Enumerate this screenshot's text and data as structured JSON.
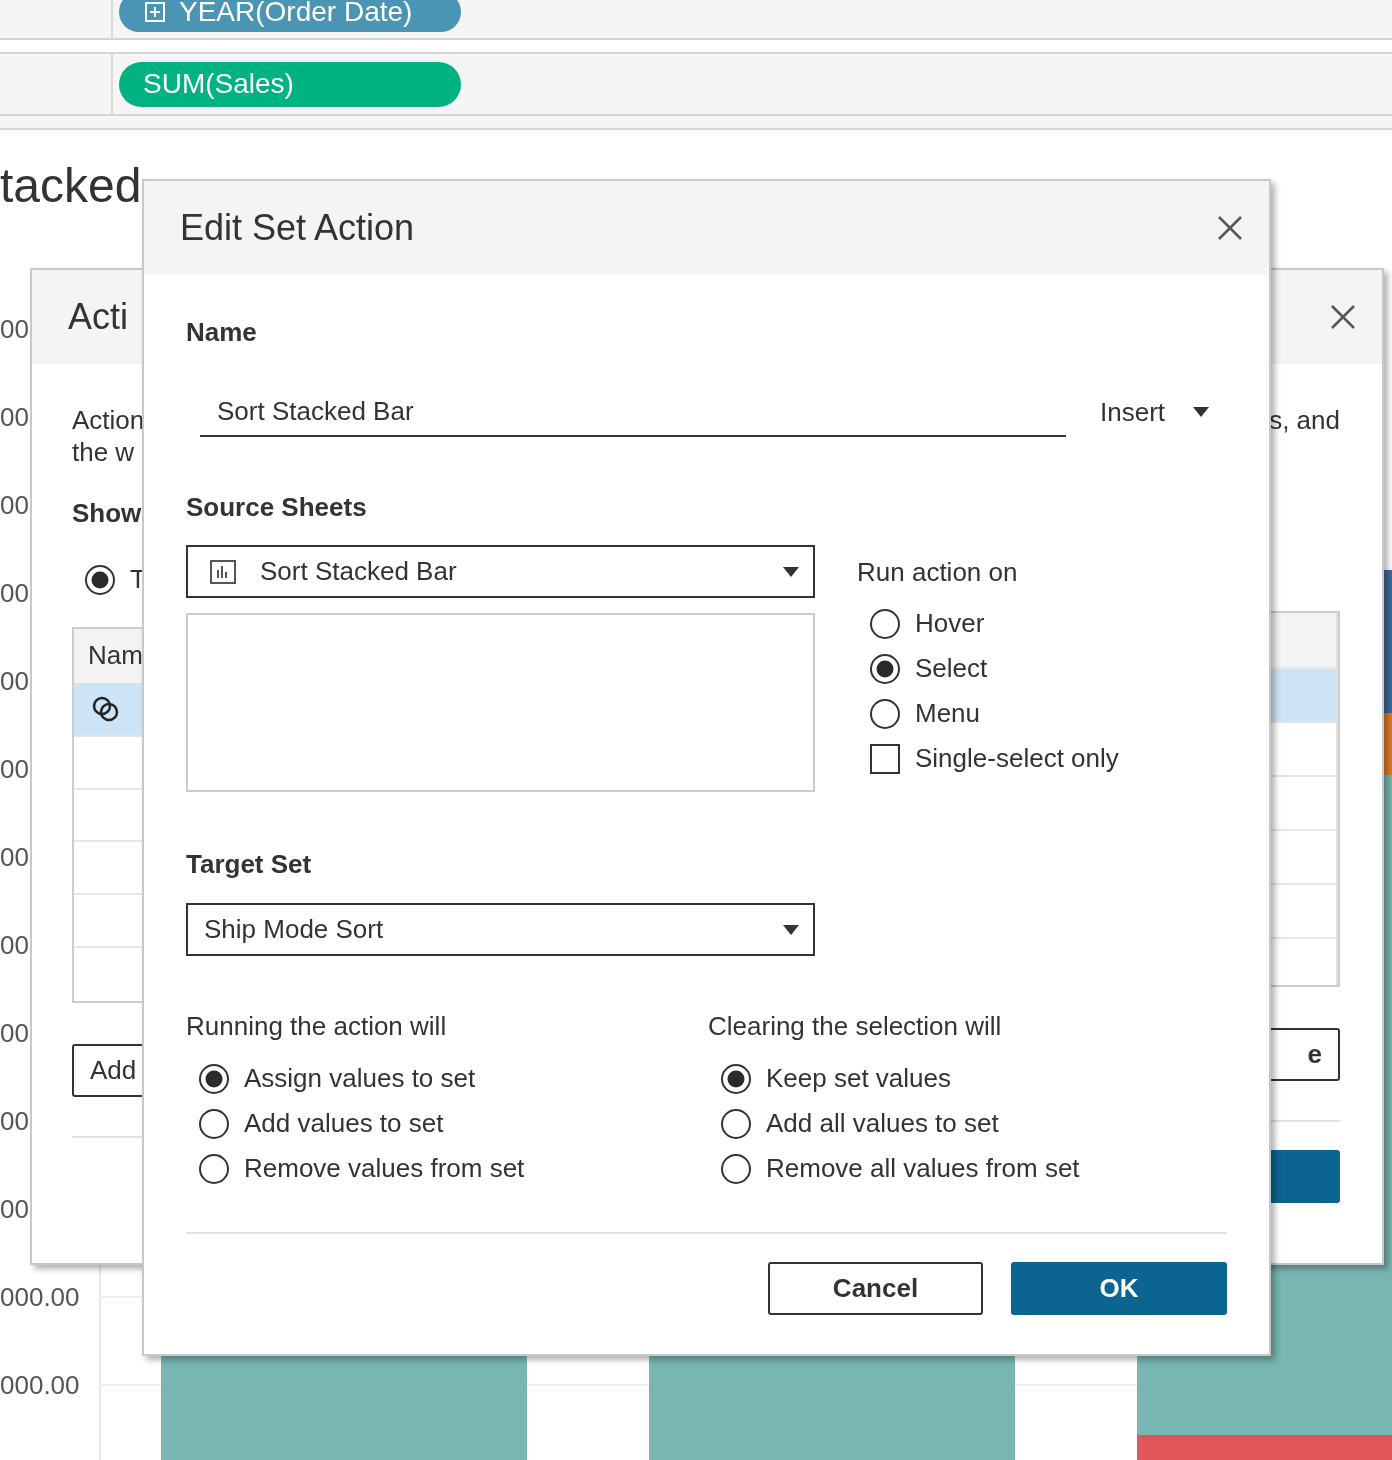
{
  "shelf": [
    {
      "label": "YEAR(Order Date)",
      "expandable": true,
      "color": "#4a95b3"
    },
    {
      "label": "SUM(Sales)",
      "expandable": false,
      "color": "#00b181"
    }
  ],
  "sheet_title": "tacked",
  "axis_labels": [
    "00",
    "00",
    "00",
    "00",
    "00",
    "00",
    "00",
    "00",
    "00",
    "00",
    "00",
    "000.00",
    "000.00"
  ],
  "actions_dialog": {
    "title": "Acti",
    "description_lines": [
      "Action",
      "the w"
    ],
    "description_end": "s, and",
    "show_label": "Show",
    "show_option": {
      "label": "T",
      "selected": true
    },
    "table": {
      "header": "Nam",
      "rows": [
        {
          "selected": true
        }
      ]
    },
    "add_button": "Add",
    "edit_button": "e"
  },
  "edit_dialog": {
    "title": "Edit Set Action",
    "name_label": "Name",
    "name_value": "Sort Stacked Bar",
    "insert_label": "Insert",
    "source_label": "Source Sheets",
    "source_sheet": "Sort Stacked Bar",
    "run_label": "Run action on",
    "run_options": [
      {
        "label": "Hover",
        "selected": false
      },
      {
        "label": "Select",
        "selected": true
      },
      {
        "label": "Menu",
        "selected": false
      }
    ],
    "single_select": {
      "label": "Single-select only",
      "checked": false
    },
    "target_label": "Target Set",
    "target_value": "Ship Mode Sort",
    "running_label": "Running the action will",
    "running_options": [
      {
        "label": "Assign values to set",
        "selected": true
      },
      {
        "label": "Add values to set",
        "selected": false
      },
      {
        "label": "Remove values from set",
        "selected": false
      }
    ],
    "clearing_label": "Clearing the selection will",
    "clearing_options": [
      {
        "label": "Keep set values",
        "selected": true
      },
      {
        "label": "Add all values to set",
        "selected": false
      },
      {
        "label": "Remove all values from set",
        "selected": false
      }
    ],
    "cancel_button": "Cancel",
    "ok_button": "OK"
  }
}
